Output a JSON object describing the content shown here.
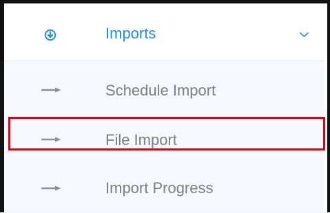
{
  "imports_menu": {
    "label": "Imports",
    "items": [
      {
        "label": "Schedule Import"
      },
      {
        "label": "File Import",
        "selected": true
      },
      {
        "label": "Import Progress"
      }
    ]
  },
  "icons": {
    "parent": "download-circle-icon",
    "toggle": "chevron-down-icon",
    "items": "arrow-right-icon"
  },
  "colors": {
    "accent": "#1f8ee6",
    "selection_outline": "#e1000f",
    "submenu_bg": "#f5f8fc",
    "submenu_text": "#7d7d7d"
  }
}
